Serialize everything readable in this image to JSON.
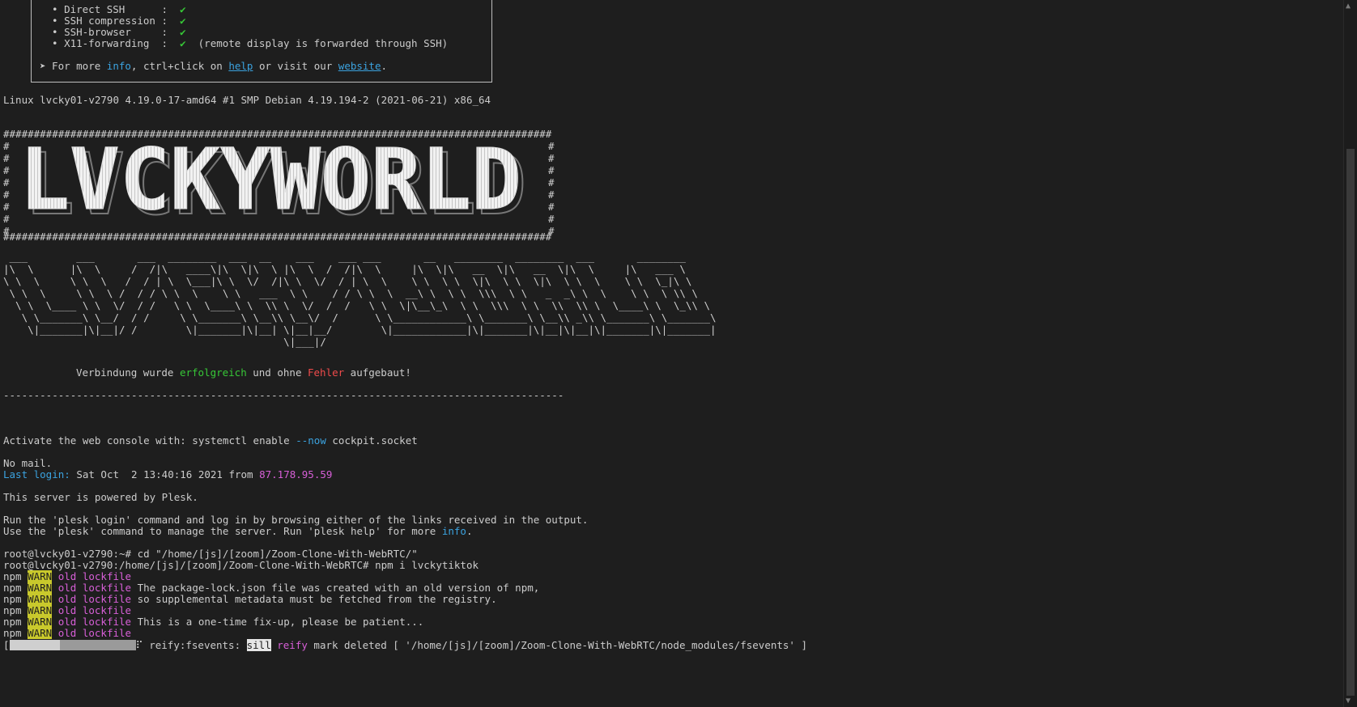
{
  "banner": {
    "features": [
      {
        "name": "Direct SSH     ",
        "check": "✔",
        "note": ""
      },
      {
        "name": "SSH compression",
        "check": "✔",
        "note": ""
      },
      {
        "name": "SSH-browser    ",
        "check": "✔",
        "note": ""
      },
      {
        "name": "X11-forwarding ",
        "check": "✔",
        "note": "(remote display is forwarded through SSH)"
      }
    ],
    "more_prefix": "➤ For more ",
    "info_word": "info",
    "more_mid": ", ctrl+click on ",
    "help_link": "help",
    "more_mid2": " or visit our ",
    "website_link": "website",
    "more_end": "."
  },
  "uname_line": "Linux lvcky01-v2790 4.19.0-17-amd64 #1 SMP Debian 4.19.194-2 (2021-06-21) x86_64",
  "logo_text": "LVCKYWORLD",
  "greeting": {
    "prefix": "Verbindung wurde ",
    "success": "erfolgreich",
    "mid": " und ohne ",
    "error": "Fehler",
    "suffix": " aufgebaut!"
  },
  "activate": {
    "prefix": "Activate the web console with: systemctl enable ",
    "flag": "--now",
    "suffix": " cockpit.socket"
  },
  "no_mail": "No mail.",
  "last_login": {
    "label": "Last login:",
    "when": " Sat Oct  2 13:40:16 2021 from ",
    "ip": "87.178.95.59"
  },
  "powered": "This server is powered by Plesk.",
  "plesk_line1": "Run the 'plesk login' command and log in by browsing either of the links received in the output.",
  "plesk_line2_prefix": "Use the 'plesk' command to manage the server. Run 'plesk help' for more ",
  "plesk_line2_info": "info",
  "plesk_line2_end": ".",
  "cmd1": "root@lvcky01-v2790:~# cd \"/home/[js]/[zoom]/Zoom-Clone-With-WebRTC/\"",
  "cmd2": "root@lvcky01-v2790:/home/[js]/[zoom]/Zoom-Clone-With-WebRTC# npm i lvckytiktok",
  "npm_warn": [
    {
      "npm": "npm ",
      "warn": "WARN",
      "kw": " old lockfile",
      "msg": ""
    },
    {
      "npm": "npm ",
      "warn": "WARN",
      "kw": " old lockfile",
      "msg": " The package-lock.json file was created with an old version of npm,"
    },
    {
      "npm": "npm ",
      "warn": "WARN",
      "kw": " old lockfile",
      "msg": " so supplemental metadata must be fetched from the registry."
    },
    {
      "npm": "npm ",
      "warn": "WARN",
      "kw": " old lockfile",
      "msg": ""
    },
    {
      "npm": "npm ",
      "warn": "WARN",
      "kw": " old lockfile",
      "msg": " This is a one-time fix-up, please be patient..."
    },
    {
      "npm": "npm ",
      "warn": "WARN",
      "kw": " old lockfile",
      "msg": ""
    }
  ],
  "progress_line": {
    "spinner": "⠏",
    "task": " reify:fsevents: ",
    "level": "sill",
    "kw": " reify",
    "msg": " mark deleted [ '/home/[js]/[zoom]/Zoom-Clone-With-WebRTC/node_modules/fsevents' ]",
    "progress_fraction": 0.4
  },
  "colors": {
    "background": "#1e1e1e",
    "text": "#cccccc",
    "link_blue": "#3ba3e0",
    "green": "#37c837",
    "red": "#ef4b4b",
    "magenta": "#d75fd7",
    "warn_bg": "#c9c92c"
  }
}
